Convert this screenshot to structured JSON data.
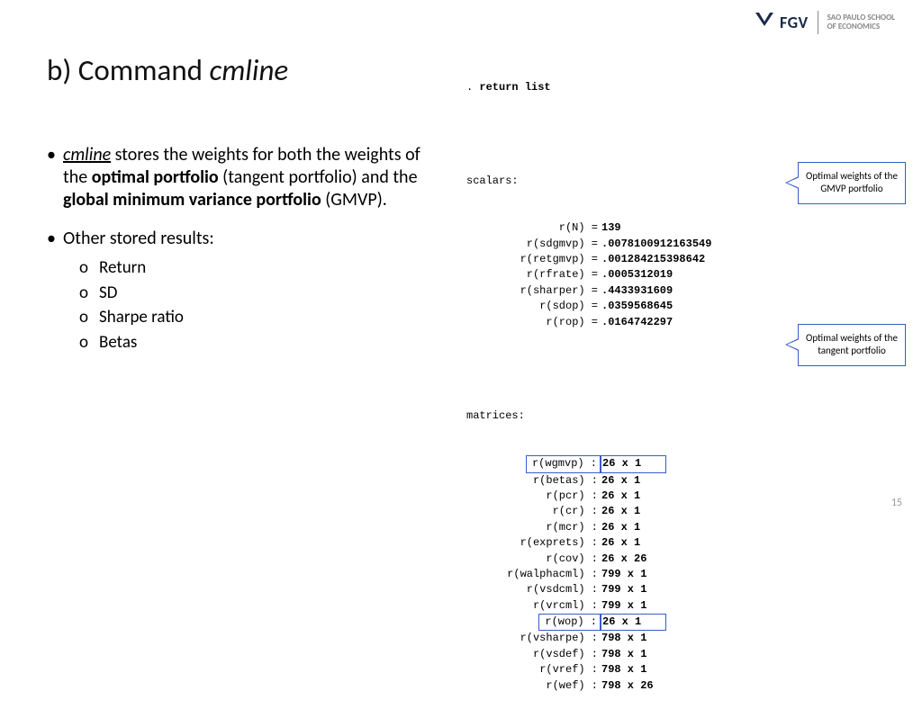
{
  "logo": {
    "brand": "FGV",
    "school_line1": "SAO PAULO SCHOOL",
    "school_line2": "OF ECONOMICS"
  },
  "title": {
    "prefix": "b) Command ",
    "cmd": "cmline"
  },
  "bullet1": {
    "p1": "cmline",
    "p2": " stores the weights for both the weights of the ",
    "p3": "optimal portfolio",
    "p4": " (tangent portfolio) and the ",
    "p5": "global minimum variance portfolio",
    "p6": " (GMVP)."
  },
  "bullet2": {
    "text": "Other stored results:",
    "subs": [
      "Return",
      "SD",
      "Sharpe ratio",
      "Betas"
    ]
  },
  "code": {
    "cmd": ". return list",
    "scalars_hdr": "scalars:",
    "scalars": [
      {
        "k": "r(N) =",
        "v": "139"
      },
      {
        "k": "r(sdgmvp) =",
        "v": ".0078100912163549"
      },
      {
        "k": "r(retgmvp) =",
        "v": ".001284215398642"
      },
      {
        "k": "r(rfrate) =",
        "v": ".0005312019"
      },
      {
        "k": "r(sharper) =",
        "v": ".4433931609"
      },
      {
        "k": "r(sdop) =",
        "v": ".0359568645"
      },
      {
        "k": "r(rop) =",
        "v": ".0164742297"
      }
    ],
    "matrices_hdr": "matrices:",
    "matrices": [
      {
        "k": "r(wgmvp) :",
        "v": "26 x 1",
        "hl": true
      },
      {
        "k": "r(betas) :",
        "v": "26 x 1"
      },
      {
        "k": "r(pcr) :",
        "v": "26 x 1"
      },
      {
        "k": "r(cr) :",
        "v": "26 x 1"
      },
      {
        "k": "r(mcr) :",
        "v": "26 x 1"
      },
      {
        "k": "r(exprets) :",
        "v": "26 x 1"
      },
      {
        "k": "r(cov) :",
        "v": "26 x 26"
      },
      {
        "k": "r(walphacml) :",
        "v": "799 x 1"
      },
      {
        "k": "r(vsdcml) :",
        "v": "799 x 1"
      },
      {
        "k": "r(vrcml) :",
        "v": "799 x 1"
      },
      {
        "k": "r(wop) :",
        "v": "26 x 1",
        "hl": true
      },
      {
        "k": "r(vsharpe) :",
        "v": "798 x 1"
      },
      {
        "k": "r(vsdef) :",
        "v": "798 x 1"
      },
      {
        "k": "r(vref) :",
        "v": "798 x 1"
      },
      {
        "k": "r(wef) :",
        "v": "798 x 26"
      }
    ]
  },
  "callouts": {
    "c1": "Optimal weights of the GMVP portfolio",
    "c2": "Optimal weights of the tangent portfolio"
  },
  "page": "15"
}
